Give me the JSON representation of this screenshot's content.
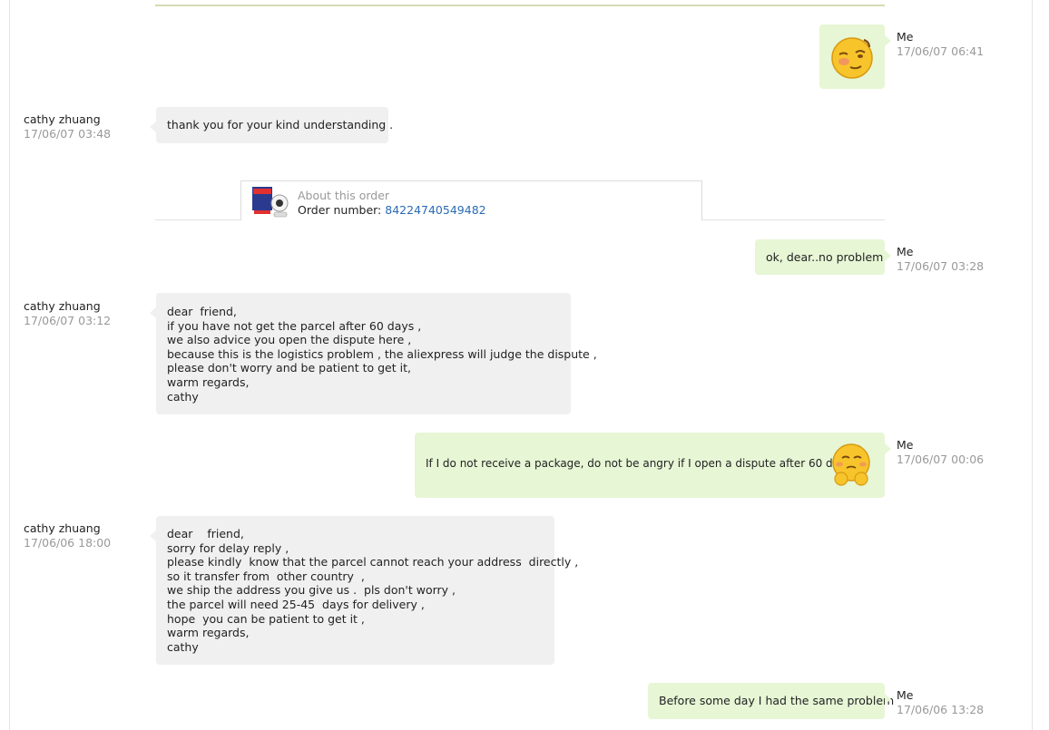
{
  "messages": [
    {
      "id": "m1",
      "from": "me",
      "name": "Me",
      "time": "17/06/07 06:41",
      "emoji": "smirk-emoji"
    },
    {
      "id": "m2",
      "from": "seller",
      "name": "cathy zhuang",
      "time": "17/06/07 03:48",
      "lines": [
        "thank you for your kind understanding ."
      ]
    },
    {
      "id": "m3",
      "from": "me",
      "name": "Me",
      "time": "17/06/07 03:28",
      "lines": [
        "ok, dear..no problem"
      ]
    },
    {
      "id": "m4",
      "from": "seller",
      "name": "cathy zhuang",
      "time": "17/06/07 03:12",
      "lines": [
        "dear  friend,",
        "if you have not get the parcel after 60 days ,",
        "we also advice you open the dispute here ,",
        "because this is the logistics problem , the aliexpress will judge the dispute ,",
        "please don't worry and be patient to get it,",
        "warm regards,",
        "cathy"
      ]
    },
    {
      "id": "m5",
      "from": "me",
      "name": "Me",
      "time": "17/06/07 00:06",
      "lines": [
        "If I do not receive a package, do not be angry if I open a dispute after 60 days"
      ],
      "emoji": "shy-emoji"
    },
    {
      "id": "m6",
      "from": "seller",
      "name": "cathy zhuang",
      "time": "17/06/06 18:00",
      "lines": [
        "dear    friend,",
        "sorry for delay reply ,",
        "please kindly  know that the parcel cannot reach your address  directly ,",
        "so it transfer from  other country  ,",
        "we ship the address you give us .  pls don't worry ,",
        "the parcel will need 25-45  days for delivery ,",
        "hope  you can be patient to get it ,",
        "warm regards,",
        "cathy"
      ]
    },
    {
      "id": "m7",
      "from": "me",
      "name": "Me",
      "time": "17/06/06 13:28",
      "lines": [
        "Before some day I had the same problem"
      ]
    }
  ],
  "order": {
    "title": "About this order",
    "number_label": "Order number:",
    "number": "84224740549482",
    "thumbnail_icon": "wifi-camera-product-thumbnail",
    "link_color": "#2a6bb5"
  },
  "colors": {
    "seller_bubble": "#f0f0f0",
    "my_bubble": "#e7f6d5",
    "timestamp": "#999999"
  }
}
